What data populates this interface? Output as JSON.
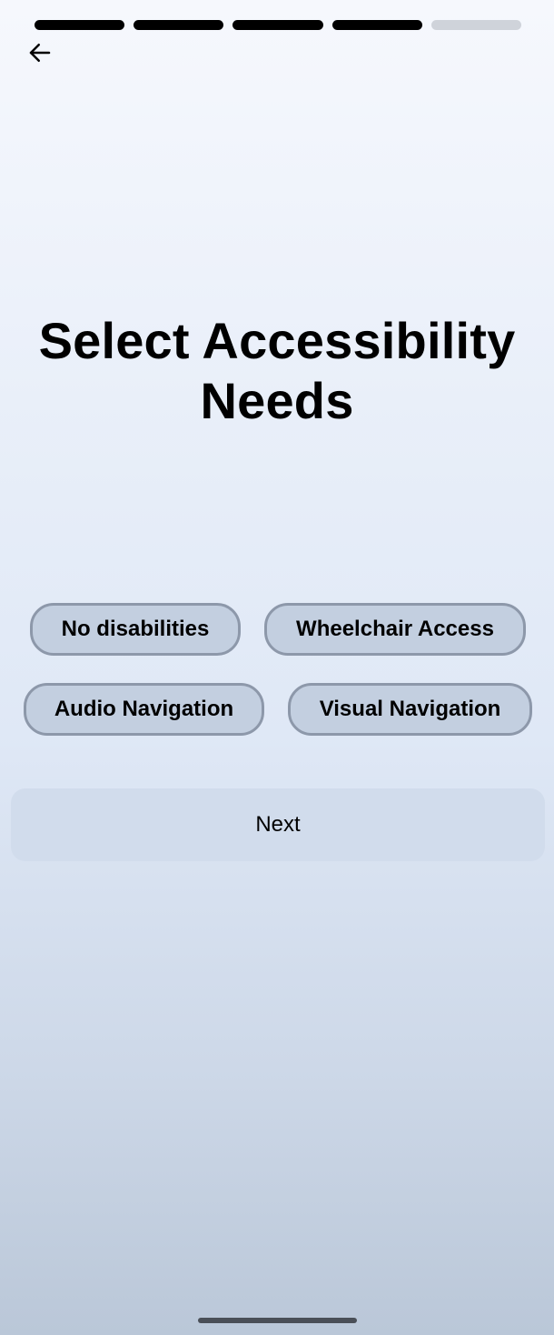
{
  "progress": {
    "total_steps": 5,
    "completed_steps": 4
  },
  "header": {
    "back_icon": "arrow-left-icon"
  },
  "main": {
    "title": "Select Accessibility Needs",
    "options": [
      {
        "label": "No disabilities"
      },
      {
        "label": "Wheelchair Access"
      },
      {
        "label": "Audio Navigation"
      },
      {
        "label": "Visual Navigation"
      }
    ],
    "next_label": "Next"
  },
  "colors": {
    "chip_background": "#c3cfe0",
    "chip_border": "#8d98aa",
    "progress_active": "#000000",
    "progress_inactive": "#cfd3da",
    "next_background": "#d1dcec"
  }
}
